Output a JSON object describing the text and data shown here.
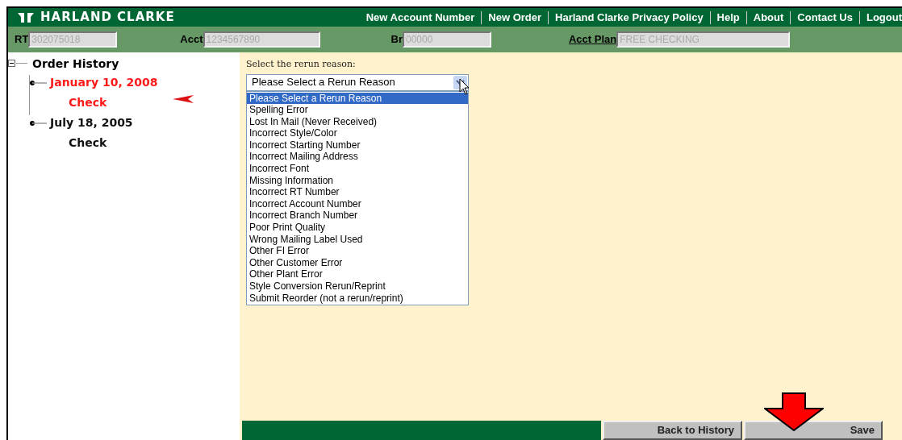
{
  "header": {
    "brand": "HARLAND CLARKE",
    "nav": [
      "New Account Number",
      "New Order",
      "Harland Clarke Privacy Policy",
      "Help",
      "About",
      "Contact Us",
      "Logout"
    ]
  },
  "fields": [
    {
      "label": "RT",
      "value": "302075018",
      "kind": "plain"
    },
    {
      "label": "Acct",
      "value": "1234567890",
      "kind": "plain"
    },
    {
      "label": "Br",
      "value": "00000",
      "kind": "plain"
    },
    {
      "label": "Acct Plan",
      "value": "FREE CHECKING",
      "kind": "link"
    }
  ],
  "tree": {
    "label": "Order History",
    "expanded": true,
    "children": [
      {
        "label": "January 10, 2008",
        "selected": true,
        "children": [
          {
            "label": "Check",
            "selected": true
          }
        ]
      },
      {
        "label": "July 18, 2005",
        "selected": false,
        "children": [
          {
            "label": "Check",
            "selected": false
          }
        ]
      }
    ]
  },
  "rerun": {
    "prompt": "Select the rerun reason:",
    "value": "Please Select a Rerun Reason",
    "options": [
      {
        "label": "Please Select a Rerun Reason",
        "selected": true
      },
      {
        "label": "Spelling Error",
        "selected": false
      },
      {
        "label": "Lost In Mail (Never Received)",
        "selected": false
      },
      {
        "label": "Incorrect Style/Color",
        "selected": false
      },
      {
        "label": "Incorrect Starting Number",
        "selected": false
      },
      {
        "label": "Incorrect Mailing Address",
        "selected": false
      },
      {
        "label": "Incorrect Font",
        "selected": false
      },
      {
        "label": "Missing Information",
        "selected": false
      },
      {
        "label": "Incorrect RT Number",
        "selected": false
      },
      {
        "label": "Incorrect Account Number",
        "selected": false
      },
      {
        "label": "Incorrect Branch Number",
        "selected": false
      },
      {
        "label": "Poor Print Quality",
        "selected": false
      },
      {
        "label": "Wrong Mailing Label Used",
        "selected": false
      },
      {
        "label": "Other FI Error",
        "selected": false
      },
      {
        "label": "Other Customer Error",
        "selected": false
      },
      {
        "label": "Other Plant Error",
        "selected": false
      },
      {
        "label": "Style Conversion Rerun/Reprint",
        "selected": false
      },
      {
        "label": "Submit Reorder (not a rerun/reprint)",
        "selected": false
      }
    ]
  },
  "buttons": [
    "Back to History",
    "Save"
  ]
}
